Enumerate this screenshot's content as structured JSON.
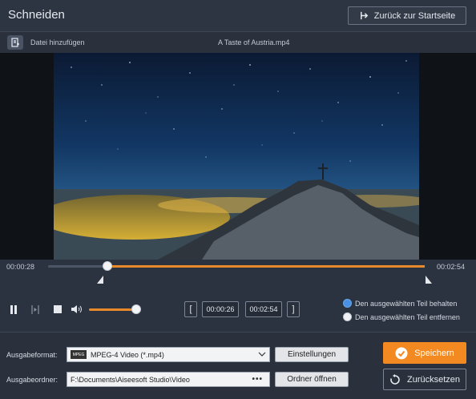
{
  "header": {
    "title": "Schneiden",
    "home_button_label": "Zurück zur Startseite"
  },
  "filebar": {
    "add_file_label": "Datei hinzufügen",
    "filename": "A Taste of Austria.mp4"
  },
  "timeline": {
    "current_time": "00:00:28",
    "end_time": "00:02:54",
    "playhead_fraction": 0.16,
    "selection_start_fraction": 0.16,
    "selection_end_fraction": 1.0
  },
  "controls": {
    "start_time": "00:00:26",
    "end_time": "00:02:54",
    "set_start_symbol": "[",
    "set_end_symbol": "]",
    "volume_fraction": 0.9
  },
  "options": {
    "keep_label": "Den ausgewählten Teil behalten",
    "remove_label": "Den ausgewählten Teil entfernen",
    "selected": "keep"
  },
  "output": {
    "format_label": "Ausgabeformat:",
    "format_value": "MPEG-4 Video (*.mp4)",
    "format_icon_text": "MPEG",
    "settings_button": "Einstellungen",
    "folder_label": "Ausgabeordner:",
    "folder_value": "F:\\Documents\\Aiseesoft Studio\\Video",
    "folder_dots": "•••",
    "open_folder_button": "Ordner öffnen",
    "save_button": "Speichern",
    "reset_button": "Zurücksetzen"
  },
  "colors": {
    "accent": "#f28a21",
    "background": "#2c3340",
    "radio_selected": "#4a90e2"
  }
}
